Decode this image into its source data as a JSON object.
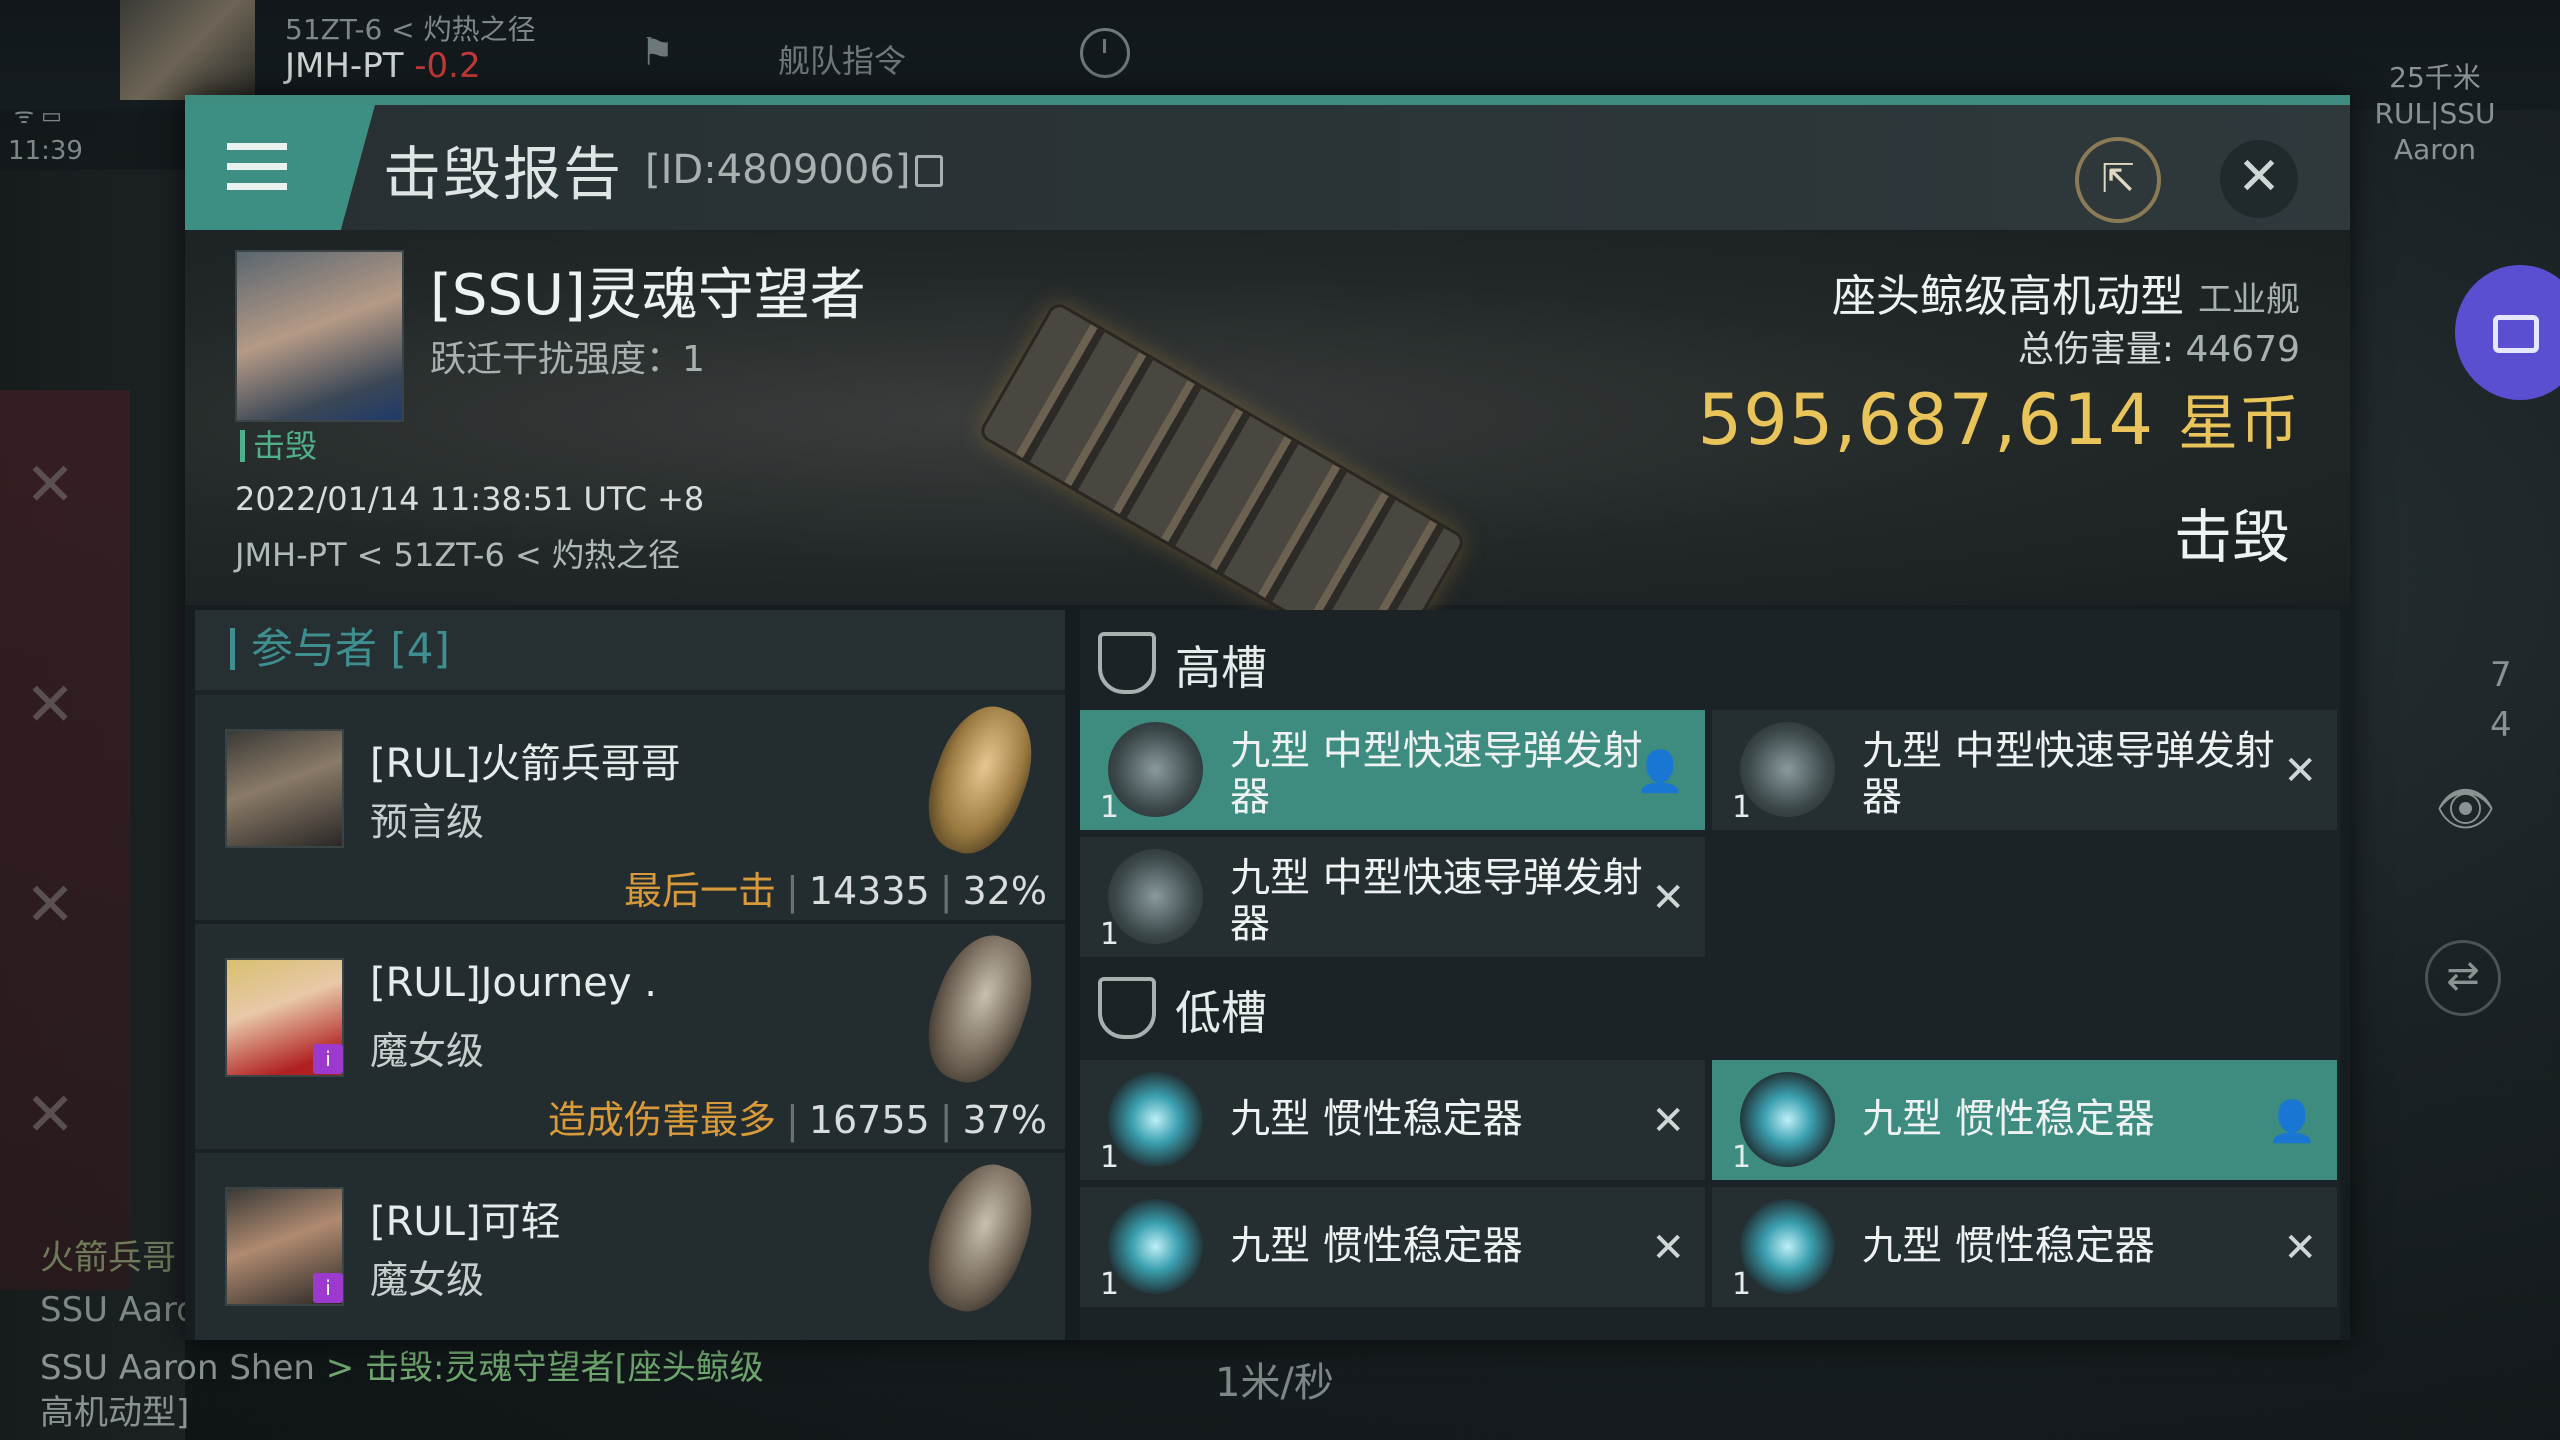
{
  "hud": {
    "location_line1": "51ZT-6 < 灼热之径",
    "system_name": "JMH-PT",
    "security": "-0.2",
    "fleet_command": "舰队指令",
    "clock": "11:39",
    "speed": "1米/秒",
    "target": {
      "distance": "25千米",
      "corp": "RUL|SSU",
      "name": "Aaron"
    },
    "counts": [
      "7",
      "4"
    ],
    "chat": {
      "line1": "火箭兵哥",
      "line2": "SSU Aaro",
      "line3_name": "SSU Aaron Shen",
      "line3_msg": "> 击毁:灵魂守望者[座头鲸级",
      "line4": "高机动型]"
    }
  },
  "modal": {
    "title": "击毁报告",
    "id_label": "[ID:4809006]",
    "victim": {
      "name": "[SSU]灵魂守望者",
      "warp_label": "跃迁干扰强度：1",
      "tag": "击毁",
      "datetime": "2022/01/14 11:38:51 UTC +8",
      "route": "JMH-PT < 51ZT-6 < 灼热之径"
    },
    "ship": {
      "name": "座头鲸级高机动型",
      "class": "工业舰",
      "total_damage_label": "总伤害量:",
      "total_damage": "44679",
      "value": "595,687,614",
      "value_unit": "星币",
      "status": "击毁"
    },
    "participants": {
      "title": "参与者 [4]",
      "rows": [
        {
          "name": "[RUL]火箭兵哥哥",
          "ship": "预言级",
          "label": "最后一击",
          "damage": "14335",
          "percent": "32%"
        },
        {
          "name": "[RUL]Journey .",
          "ship": "魔女级",
          "label": "造成伤害最多",
          "damage": "16755",
          "percent": "37%"
        },
        {
          "name": "[RUL]可轻",
          "ship": "魔女级",
          "label": "",
          "damage": "",
          "percent": ""
        }
      ]
    },
    "slots": {
      "high": {
        "title": "高槽",
        "items": [
          {
            "name": "九型 中型快速导弹发射器",
            "qty": "1",
            "state": "dropped"
          },
          {
            "name": "九型 中型快速导弹发射器",
            "qty": "1",
            "state": "destroyed"
          },
          {
            "name": "九型 中型快速导弹发射器",
            "qty": "1",
            "state": "destroyed"
          }
        ]
      },
      "low": {
        "title": "低槽",
        "items": [
          {
            "name": "九型 惯性稳定器",
            "qty": "1",
            "state": "destroyed"
          },
          {
            "name": "九型 惯性稳定器",
            "qty": "1",
            "state": "dropped"
          },
          {
            "name": "九型 惯性稳定器",
            "qty": "1",
            "state": "destroyed"
          },
          {
            "name": "九型 惯性稳定器",
            "qty": "1",
            "state": "destroyed"
          }
        ]
      }
    },
    "icons": {
      "dropped": "person-icon",
      "destroyed": "x-icon"
    },
    "colors": {
      "accent": "#3e8c80",
      "isk": "#e9c45a",
      "highlight_label": "#d89a3a",
      "kill_tag": "#4fb08a"
    }
  }
}
